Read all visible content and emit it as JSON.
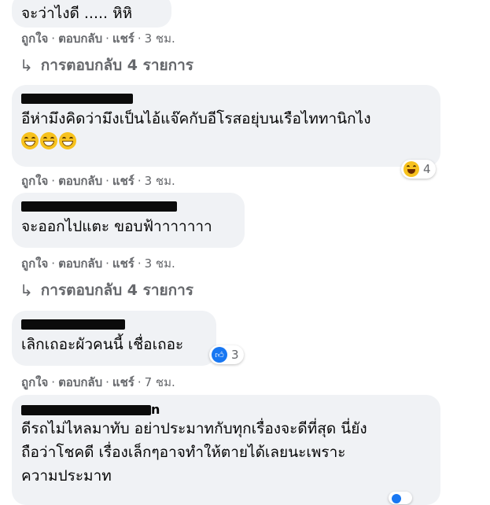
{
  "colors": {
    "bubble": "#f0f2f5",
    "meta": "#65676b",
    "like_blue": "#1877f2"
  },
  "top_comment": {
    "text": "จะว่าไงดี ..... หิหิ"
  },
  "actions_labels": {
    "like": "ถูกใจ",
    "reply": "ตอบกลับ",
    "share": "แชร์",
    "dot": "·"
  },
  "times": [
    "3 ชม.",
    "3 ชม.",
    "3 ชม.",
    "7 ชม."
  ],
  "replies_label": "การตอบกลับ 4 รายการ",
  "comments": [
    {
      "text": "อีห่ามึงคิดว่ามึงเป็นไอ้แจ๊คกับอีโรสอยุ่บนเรือไททานิกไง",
      "emoji_icon": "grinning-squinting-face-icon",
      "reaction": {
        "icon": "laughing-face-icon",
        "count": "4"
      }
    },
    {
      "text": "จะออกไปแตะ ขอบฟ้าาาาาาา"
    },
    {
      "text": "เลิกเถอะผัวคนนี้ เชื่อเถอะ",
      "reaction": {
        "icon": "like-icon",
        "count": "3"
      }
    },
    {
      "name_suffix": "n",
      "lines": [
        "ดีรถไม่ไหลมาทับ อย่าประมาทกับทุกเรื่องจะดีที่สุด นี่ยัง",
        "ถือว่าโชคดี เรื่องเล็กๆอาจทำให้ตายได้เลยนะเพราะ",
        "ความประมาท"
      ]
    }
  ]
}
